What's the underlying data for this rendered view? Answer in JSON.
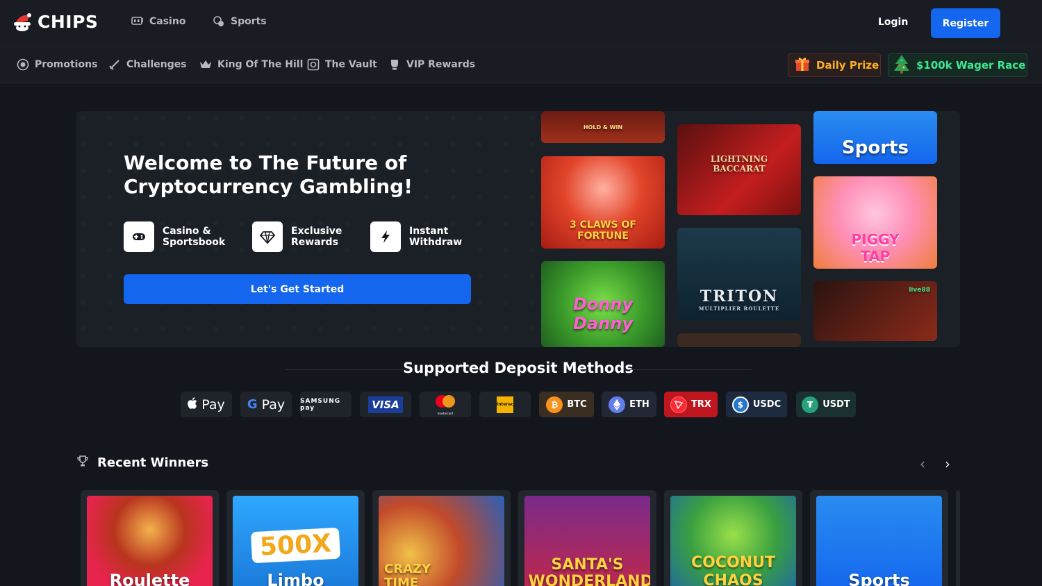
{
  "header": {
    "logo": "CHIPS",
    "nav": [
      {
        "label": "Casino",
        "icon": "slot-machine-icon"
      },
      {
        "label": "Sports",
        "icon": "sports-icon"
      }
    ],
    "login_label": "Login",
    "register_label": "Register"
  },
  "subnav": {
    "items": [
      {
        "label": "Promotions",
        "icon": "promotions-icon"
      },
      {
        "label": "Challenges",
        "icon": "sword-icon"
      },
      {
        "label": "King Of The Hill",
        "icon": "crown-icon"
      },
      {
        "label": "The Vault",
        "icon": "vault-icon"
      },
      {
        "label": "VIP Rewards",
        "icon": "vip-icon"
      }
    ],
    "daily_prize": "Daily Prize",
    "wager_race": "$100k Wager Race"
  },
  "hero": {
    "title": "Welcome to The Future of Cryptocurrency Gambling!",
    "features": [
      {
        "label": "Casino & Sportsbook",
        "icon": "gamepad-icon"
      },
      {
        "label": "Exclusive Rewards",
        "icon": "diamond-icon"
      },
      {
        "label": "Instant Withdraw",
        "icon": "lightning-icon"
      }
    ],
    "cta_label": "Let's Get Started",
    "tiles": [
      {
        "text": "HOLD & WIN"
      },
      {
        "text": "3 CLAWS OF FORTUNE"
      },
      {
        "text": "Donny Danny"
      },
      {
        "text": "LIGHTNING BACCARAT"
      },
      {
        "text": "TRITON"
      },
      {
        "text": "MULTIPLIER ROULETTE"
      },
      {
        "text": "Sports"
      },
      {
        "text": "PIGGY TAP"
      },
      {
        "text": "live88"
      }
    ]
  },
  "deposit": {
    "heading": "Supported Deposit Methods",
    "methods": [
      {
        "label": "Pay",
        "icon": "apple-icon"
      },
      {
        "label": "Pay",
        "icon": "google-icon"
      },
      {
        "label": "SAMSUNG pay",
        "icon": "samsung-pay-icon"
      },
      {
        "label": "VISA",
        "icon": "visa-icon"
      },
      {
        "label": "mastercard",
        "icon": "mastercard-icon"
      },
      {
        "label": "Interac",
        "icon": "interac-icon"
      },
      {
        "label": "BTC",
        "icon": "bitcoin-icon"
      },
      {
        "label": "ETH",
        "icon": "ethereum-icon"
      },
      {
        "label": "TRX",
        "icon": "tron-icon"
      },
      {
        "label": "USDC",
        "icon": "usdc-icon"
      },
      {
        "label": "USDT",
        "icon": "tether-icon"
      }
    ]
  },
  "winners": {
    "title": "Recent Winners",
    "cards": [
      {
        "label": "Roulette"
      },
      {
        "label": "Limbo",
        "badge": "500X"
      },
      {
        "label": "CRAZY TIME"
      },
      {
        "label": "SANTA'S WONDERLAND"
      },
      {
        "label": "COCONUT CHAOS"
      },
      {
        "label": "Sports"
      }
    ]
  },
  "colors": {
    "accent": "#1466ee",
    "background": "#13161c",
    "prize": "#ffb020",
    "race": "#3ee892"
  }
}
